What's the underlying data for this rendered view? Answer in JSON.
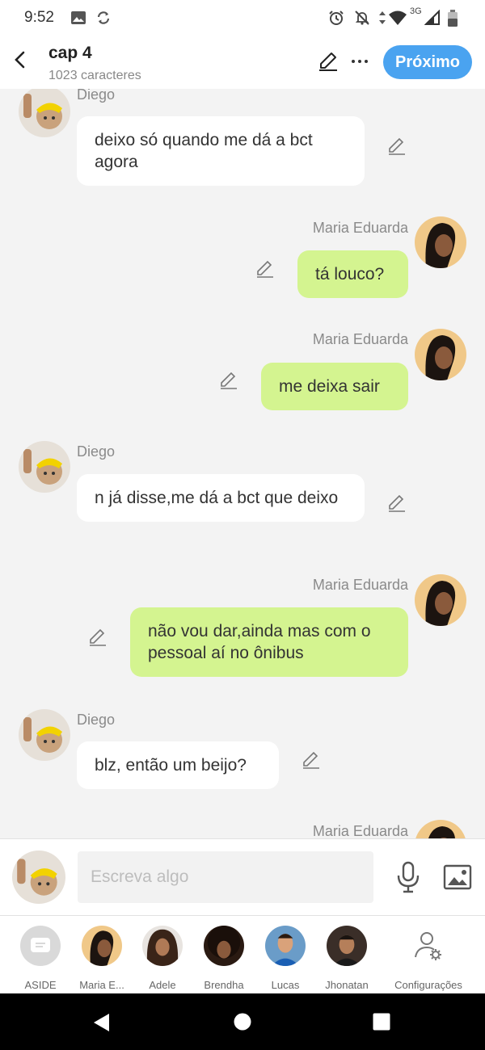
{
  "status_bar": {
    "time": "9:52",
    "network": "3G",
    "icons": [
      "image-icon",
      "sync-icon",
      "alarm-icon",
      "notifications-off-icon",
      "data-arrows-icon",
      "wifi-icon",
      "cell-signal-icon",
      "battery-icon"
    ]
  },
  "header": {
    "title": "cap 4",
    "subtitle": "1023 caracteres",
    "next_label": "Próximo",
    "colors": {
      "accent": "#4aa3f0"
    }
  },
  "messages": [
    {
      "sender": "Diego",
      "side": "left",
      "text": "deixo só quando me dá a bct agora",
      "sender_visible": "partial"
    },
    {
      "sender": "Maria Eduarda",
      "side": "right",
      "text": "tá louco?"
    },
    {
      "sender": "Maria Eduarda",
      "side": "right",
      "text": "me deixa sair"
    },
    {
      "sender": "Diego",
      "side": "left",
      "text": "n já disse,me dá a bct que deixo"
    },
    {
      "sender": "Maria Eduarda",
      "side": "right",
      "text": "não vou dar,ainda mas com o pessoal aí no ônibus"
    },
    {
      "sender": "Diego",
      "side": "left",
      "text": "blz, então um beijo?"
    },
    {
      "sender": "Maria Eduarda",
      "side": "right",
      "text": ""
    }
  ],
  "bubble_colors": {
    "incoming": "#ffffff",
    "outgoing": "#d4f490"
  },
  "composer": {
    "placeholder": "Escreva algo"
  },
  "characters": [
    {
      "label": "ASIDE",
      "icon": "aside-icon"
    },
    {
      "label": "Maria E..."
    },
    {
      "label": "Adele"
    },
    {
      "label": "Brendha"
    },
    {
      "label": "Lucas"
    },
    {
      "label": "Jhonatan"
    },
    {
      "label": "Configurações",
      "icon": "user-settings-icon"
    }
  ]
}
